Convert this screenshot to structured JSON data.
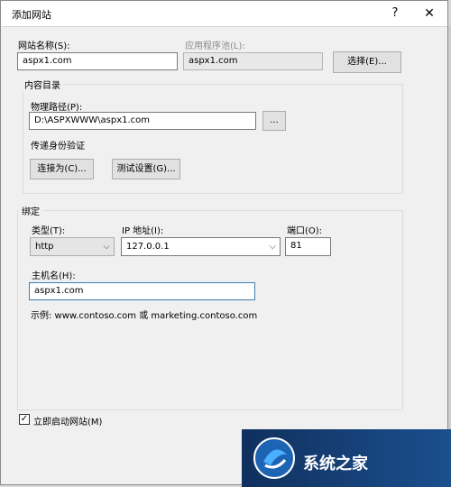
{
  "dialog": {
    "title": "添加网站",
    "help_symbol": "?",
    "close_symbol": "✕"
  },
  "site_name": {
    "label": "网站名称(S):",
    "value": "aspx1.com"
  },
  "app_pool": {
    "label": "应用程序池(L):",
    "value": "aspx1.com",
    "select_button": "选择(E)..."
  },
  "content_dir": {
    "group_title": "内容目录",
    "physical_path": {
      "label": "物理路径(P):",
      "value": "D:\\ASPXWWW\\aspx1.com",
      "browse_button": "..."
    },
    "pass_through_auth": "传递身份验证",
    "connect_as_button": "连接为(C)...",
    "test_settings_button": "测试设置(G)..."
  },
  "binding": {
    "group_title": "绑定",
    "type": {
      "label": "类型(T):",
      "value": "http"
    },
    "ip": {
      "label": "IP 地址(I):",
      "value": "127.0.0.1"
    },
    "port": {
      "label": "端口(O):",
      "value": "81"
    },
    "host": {
      "label": "主机名(H):",
      "value": "aspx1.com"
    },
    "example": "示例: www.contoso.com 或 marketing.contoso.com"
  },
  "start_now": {
    "label": "立即启动网站(M)",
    "checked": true,
    "check_glyph": "✓"
  },
  "watermark": {
    "text": "系统之家"
  },
  "icons": {
    "help": "question-icon",
    "close": "close-icon",
    "dropdown": "chevron-down-icon",
    "logo": "logo-icon"
  },
  "colors": {
    "dialog_bg": "#f0f0f0",
    "focus_border": "#3c7fb1",
    "watermark_bg": "#10305e"
  }
}
